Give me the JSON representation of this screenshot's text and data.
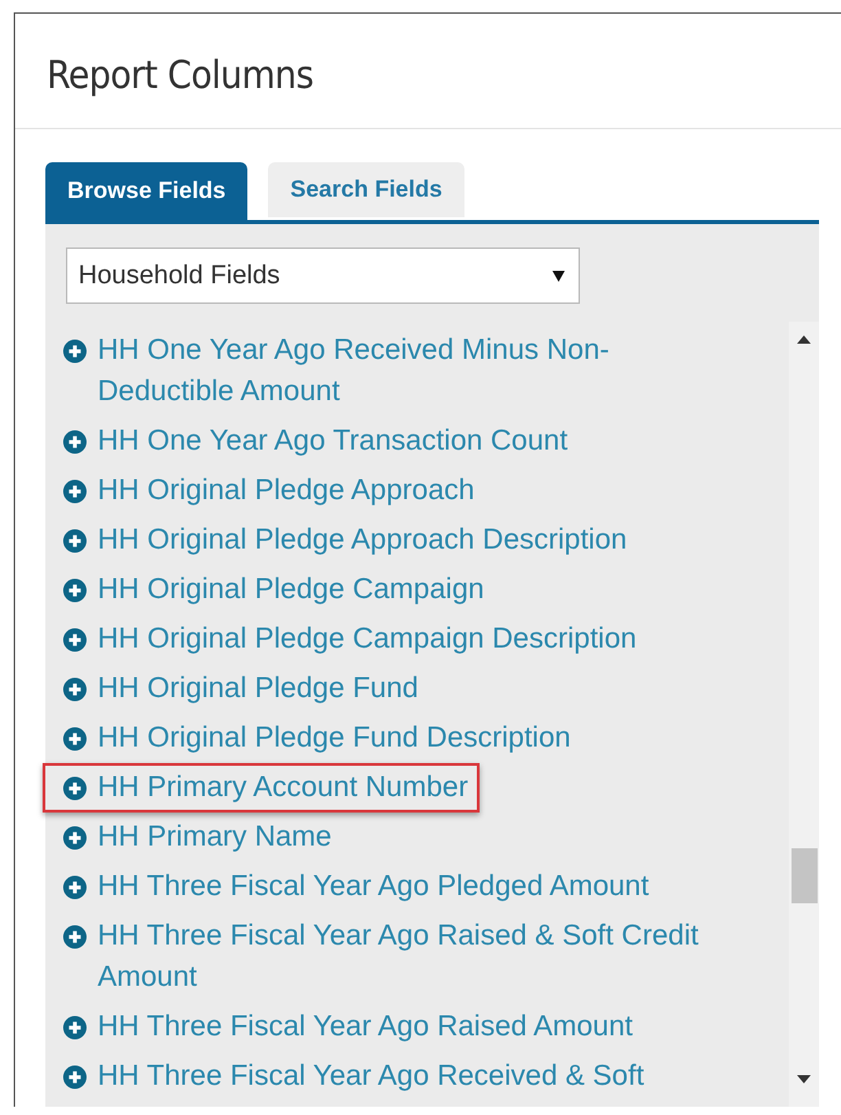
{
  "panel": {
    "title": "Report Columns"
  },
  "tabs": [
    {
      "label": "Browse Fields",
      "selected": true
    },
    {
      "label": "Search Fields",
      "selected": false
    }
  ],
  "category_select": {
    "value": "Household Fields"
  },
  "fields": [
    {
      "label": "HH One Year Ago Received Minus Non-Deductible Amount",
      "highlighted": false
    },
    {
      "label": "HH One Year Ago Transaction Count",
      "highlighted": false
    },
    {
      "label": "HH Original Pledge Approach",
      "highlighted": false
    },
    {
      "label": "HH Original Pledge Approach Description",
      "highlighted": false
    },
    {
      "label": "HH Original Pledge Campaign",
      "highlighted": false
    },
    {
      "label": "HH Original Pledge Campaign Description",
      "highlighted": false
    },
    {
      "label": "HH Original Pledge Fund",
      "highlighted": false
    },
    {
      "label": "HH Original Pledge Fund Description",
      "highlighted": false
    },
    {
      "label": "HH Primary Account Number",
      "highlighted": true
    },
    {
      "label": "HH Primary Name",
      "highlighted": false
    },
    {
      "label": "HH Three Fiscal Year Ago Pledged Amount",
      "highlighted": false
    },
    {
      "label": "HH Three Fiscal Year Ago Raised & Soft Credit Amount",
      "highlighted": false
    },
    {
      "label": "HH Three Fiscal Year Ago Raised Amount",
      "highlighted": false
    },
    {
      "label": "HH Three Fiscal Year Ago Received & Soft",
      "highlighted": false
    }
  ]
}
